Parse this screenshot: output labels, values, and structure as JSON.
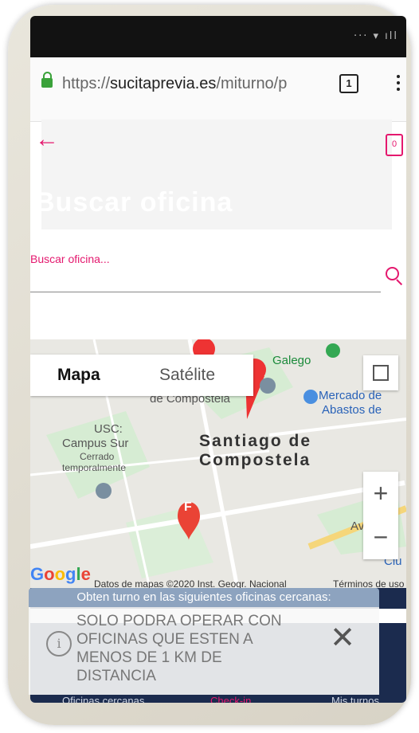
{
  "browser": {
    "url_scheme": "https://",
    "url_host": "sucitaprevia.es",
    "url_path": "/miturno/p",
    "tab_count": "1"
  },
  "header": {
    "title": "Buscar oficina"
  },
  "search": {
    "label": "Buscar oficina..."
  },
  "map": {
    "toggle_map": "Mapa",
    "toggle_satellite": "Satélite",
    "labels": {
      "galego": "Galego",
      "compostela_top": "de Compostela",
      "mercado": "Mercado de",
      "abastos": "Abastos de",
      "usc": "USC:",
      "campus": "Campus Sur",
      "cerrado": "Cerrado",
      "temporal": "temporalmente",
      "city1": "Santiago de",
      "city2": "Compostela",
      "av": "Av.",
      "ci": "Ciu"
    },
    "marker_f": "F",
    "google": "Google",
    "attribution": "Datos de mapas ©2020 Inst. Geogr. Nacional",
    "terms": "Términos de uso",
    "zoom_in": "+",
    "zoom_out": "−"
  },
  "banner": {
    "title": "Obten turno en las siguientes oficinas cercanas:"
  },
  "bottom_nav": {
    "left": "Oficinas cercanas",
    "center": "Check-in",
    "right": "Mis turnos"
  },
  "notice": {
    "text": "SOLO PODRA OPERAR CON OFICINAS QUE ESTEN A MENOS DE 1 KM DE DISTANCIA",
    "info_glyph": "i",
    "close_glyph": "✕"
  },
  "colors": {
    "accent": "#e4186e",
    "navy": "#1b2b4e"
  }
}
